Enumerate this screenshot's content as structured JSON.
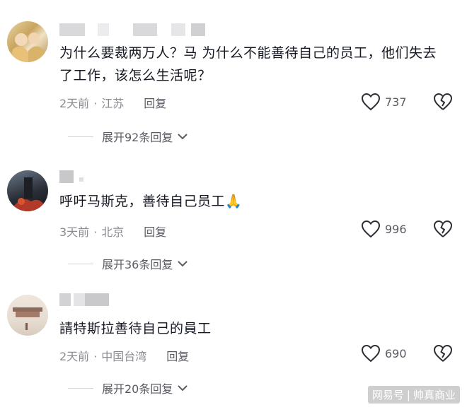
{
  "comments": [
    {
      "text": "为什么要裁两万人？马 为什么不能善待自己的员工，他们失去了工作，该怎么生活呢？",
      "time": "2天前",
      "location": "江苏",
      "reply_label": "回复",
      "likes": "737",
      "expand_label": "展开92条回复"
    },
    {
      "text": "呼吁马斯克，善待自己员工🙏",
      "time": "3天前",
      "location": "北京",
      "reply_label": "回复",
      "likes": "996",
      "expand_label": "展开36条回复"
    },
    {
      "text": "請特斯拉善待自己的員工",
      "time": "2天前",
      "location": "中国台湾",
      "reply_label": "回复",
      "likes": "690",
      "expand_label": "展开20条回复"
    }
  ],
  "watermark": {
    "source": "网易号",
    "separator": "|",
    "account": "帅真商业"
  },
  "icons": {
    "like": "heart-outline-icon",
    "dislike": "broken-heart-icon",
    "expand": "chevron-down-icon"
  }
}
